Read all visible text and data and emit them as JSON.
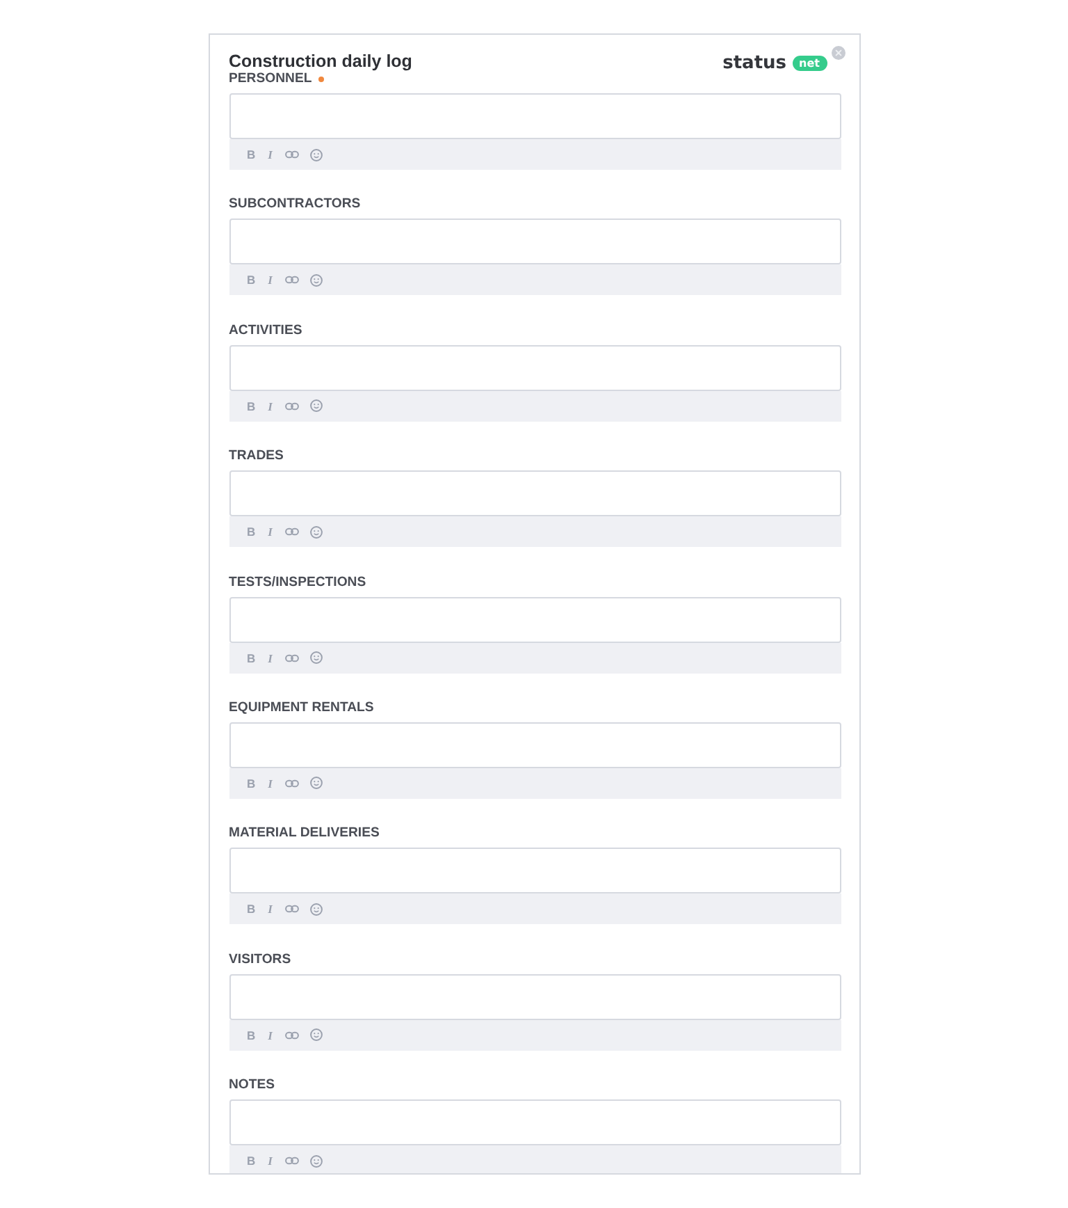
{
  "form": {
    "title": "Construction daily log",
    "logo": {
      "wordmark": "status",
      "badge": "net"
    }
  },
  "fields": [
    {
      "label": "PERSONNEL",
      "required": true,
      "toolbar": {
        "bold": "B",
        "italic": "I"
      }
    },
    {
      "label": "SUBCONTRACTORS",
      "required": false,
      "toolbar": {
        "bold": "B",
        "italic": "I"
      }
    },
    {
      "label": "ACTIVITIES",
      "required": false,
      "toolbar": {
        "bold": "B",
        "italic": "I"
      }
    },
    {
      "label": "TRADES",
      "required": false,
      "toolbar": {
        "bold": "B",
        "italic": "I"
      }
    },
    {
      "label": "TESTS/INSPECTIONS",
      "required": false,
      "toolbar": {
        "bold": "B",
        "italic": "I"
      }
    },
    {
      "label": "EQUIPMENT RENTALS",
      "required": false,
      "toolbar": {
        "bold": "B",
        "italic": "I"
      }
    },
    {
      "label": "MATERIAL DELIVERIES",
      "required": false,
      "toolbar": {
        "bold": "B",
        "italic": "I"
      }
    },
    {
      "label": "VISITORS",
      "required": false,
      "toolbar": {
        "bold": "B",
        "italic": "I"
      }
    },
    {
      "label": "NOTES",
      "required": false,
      "toolbar": {
        "bold": "B",
        "italic": "I"
      }
    }
  ]
}
